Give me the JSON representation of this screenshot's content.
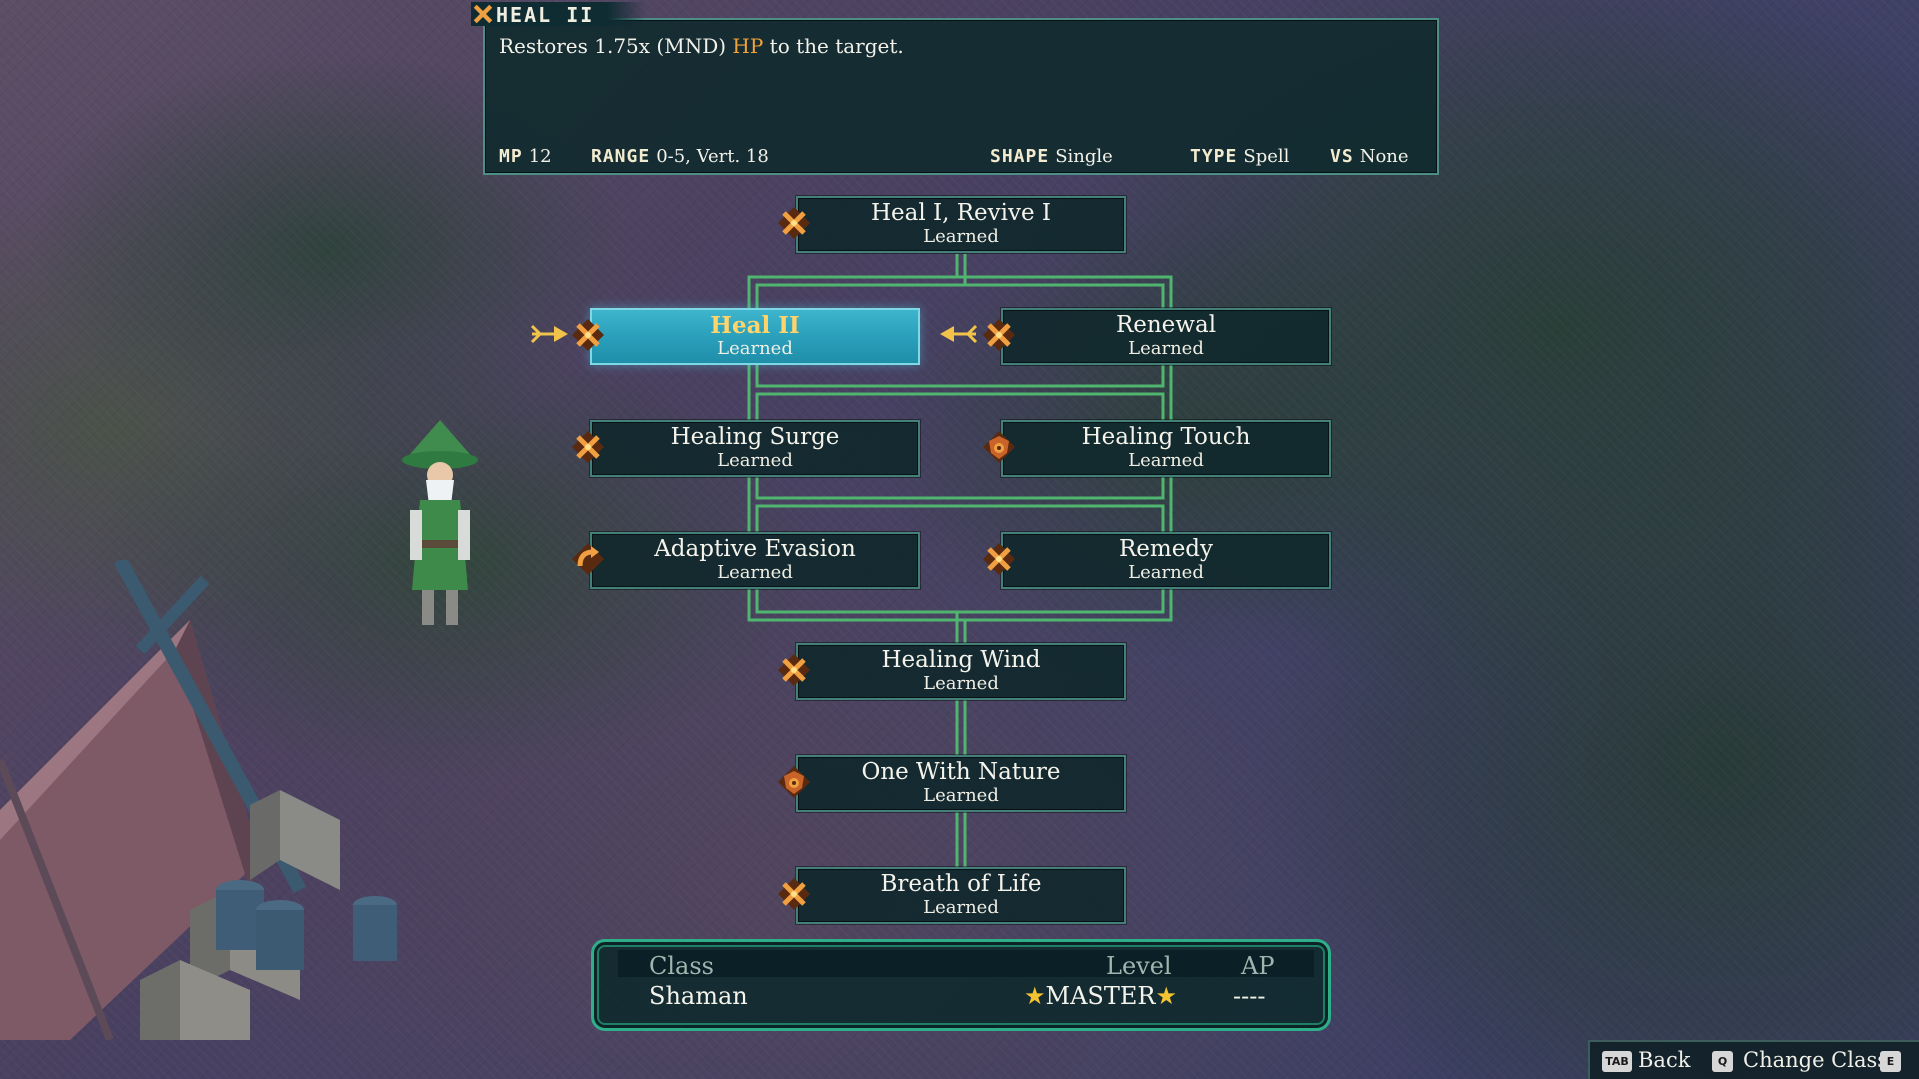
{
  "skill_info": {
    "title": "HEAL II",
    "description_before": "Restores 1.75x (MND) ",
    "description_highlight": "HP",
    "description_after": " to the target.",
    "stats": {
      "mp_label": "MP",
      "mp_value": "12",
      "range_label": "RANGE",
      "range_value": "0-5, Vert. 18",
      "shape_label": "SHAPE",
      "shape_value": "Single",
      "type_label": "TYPE",
      "type_value": "Spell",
      "vs_label": "VS",
      "vs_value": "None"
    }
  },
  "skills": [
    {
      "id": "heal-revive",
      "name": "Heal I, Revive I",
      "status": "Learned",
      "icon": "crossed-staves-icon"
    },
    {
      "id": "heal-ii",
      "name": "Heal II",
      "status": "Learned",
      "icon": "crossed-staves-icon",
      "selected": true
    },
    {
      "id": "renewal",
      "name": "Renewal",
      "status": "Learned",
      "icon": "crossed-staves-icon"
    },
    {
      "id": "healing-surge",
      "name": "Healing Surge",
      "status": "Learned",
      "icon": "crossed-staves-icon"
    },
    {
      "id": "healing-touch",
      "name": "Healing Touch",
      "status": "Learned",
      "icon": "passive-shield-icon"
    },
    {
      "id": "adaptive-evasion",
      "name": "Adaptive Evasion",
      "status": "Learned",
      "icon": "reaction-arrow-icon"
    },
    {
      "id": "remedy",
      "name": "Remedy",
      "status": "Learned",
      "icon": "crossed-staves-icon"
    },
    {
      "id": "healing-wind",
      "name": "Healing Wind",
      "status": "Learned",
      "icon": "crossed-staves-icon"
    },
    {
      "id": "one-with-nature",
      "name": "One With Nature",
      "status": "Learned",
      "icon": "passive-shield-icon"
    },
    {
      "id": "breath-of-life",
      "name": "Breath of Life",
      "status": "Learned",
      "icon": "crossed-staves-icon"
    }
  ],
  "class_panel": {
    "class_label": "Class",
    "level_label": "Level",
    "ap_label": "AP",
    "class_value": "Shaman",
    "star": "★",
    "level_value": "MASTER",
    "ap_value": "----"
  },
  "footer": {
    "back_key": "TAB",
    "back_label": "Back",
    "change_key": "Q",
    "change_label": "Change Class",
    "change_key2": "E"
  },
  "colors": {
    "accent_orange": "#f0a437",
    "selected_node": "#2aa0bc",
    "connector_green": "#4fb56f",
    "panel_border": "#4d8f86",
    "star_gold": "#f4c330"
  }
}
